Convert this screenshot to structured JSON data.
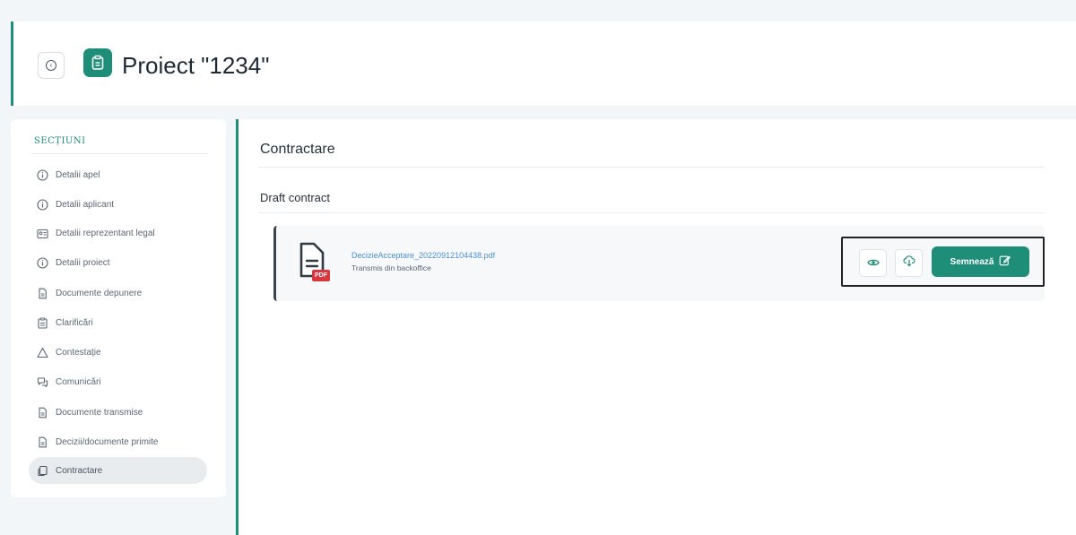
{
  "header": {
    "title": "Proiect \"1234\"",
    "back_icon": "back-circle-icon",
    "project_icon": "clipboard-icon"
  },
  "sidebar": {
    "title": "SECȚIUNI",
    "items": [
      {
        "label": "Detalii apel",
        "icon": "info-icon"
      },
      {
        "label": "Detalii aplicant",
        "icon": "info-icon"
      },
      {
        "label": "Detalii reprezentant legal",
        "icon": "id-card-icon"
      },
      {
        "label": "Detalii proiect",
        "icon": "info-icon"
      },
      {
        "label": "Documente depunere",
        "icon": "document-icon"
      },
      {
        "label": "Clarificări",
        "icon": "clipboard-icon"
      },
      {
        "label": "Contestație",
        "icon": "warning-icon"
      },
      {
        "label": "Comunicări",
        "icon": "chat-icon"
      },
      {
        "label": "Documente transmise",
        "icon": "document-icon"
      },
      {
        "label": "Decizii/documente primite",
        "icon": "document-icon"
      },
      {
        "label": "Contractare",
        "icon": "contract-icon",
        "active": true
      }
    ]
  },
  "main": {
    "section_title": "Contractare",
    "subsection_title": "Draft contract",
    "document": {
      "file_name": "DecizieAcceptare_20220912104438.pdf",
      "subtitle": "Transmis din backoffice",
      "badge": "PDF",
      "view_icon": "eye-icon",
      "download_icon": "cloud-download-icon"
    },
    "sign_button_label": "Semnează",
    "sign_icon": "edit-icon"
  },
  "colors": {
    "accent": "#1e8e78",
    "link": "#4a90d9",
    "pdf_badge": "#d9363e"
  }
}
